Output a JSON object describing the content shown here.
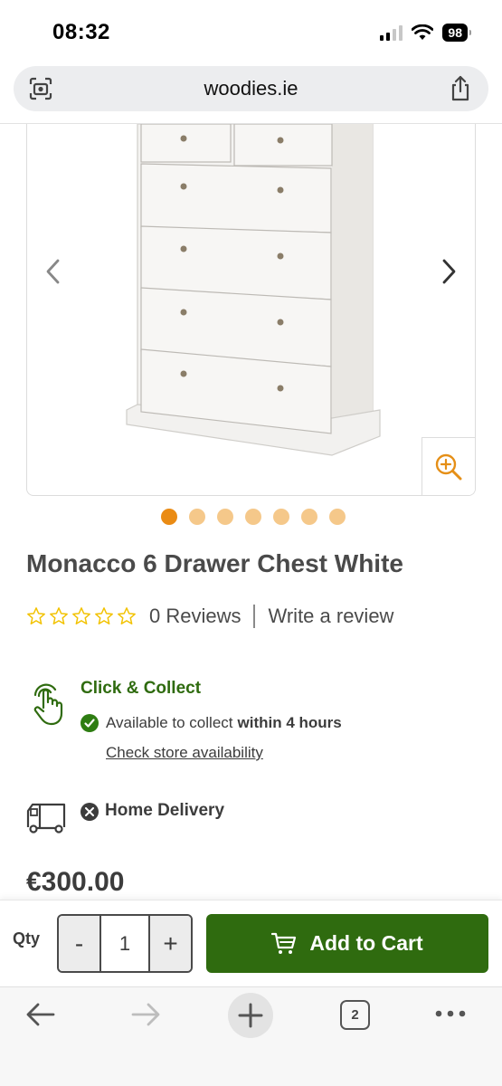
{
  "status_bar": {
    "time": "08:32",
    "battery": "98"
  },
  "browser": {
    "url": "woodies.ie",
    "tab_count": "2"
  },
  "gallery": {
    "image_count": 7,
    "active_index": 0
  },
  "product": {
    "title": "Monacco 6 Drawer Chest White",
    "rating": 0,
    "reviews_text": "0 Reviews",
    "write_review": "Write a review",
    "price": "€300.00"
  },
  "click_collect": {
    "title": "Click & Collect",
    "available_text": "Available to collect",
    "available_bold": "within 4 hours",
    "check_link": "Check store availability"
  },
  "home_delivery": {
    "title": "Home Delivery"
  },
  "cart": {
    "qty_label": "Qty",
    "minus": "-",
    "qty_value": "1",
    "plus": "+",
    "add_label": "Add to Cart"
  },
  "colors": {
    "brand_green": "#2f6b0f",
    "accent_orange": "#ea8b14",
    "star_yellow": "#f2c200"
  }
}
